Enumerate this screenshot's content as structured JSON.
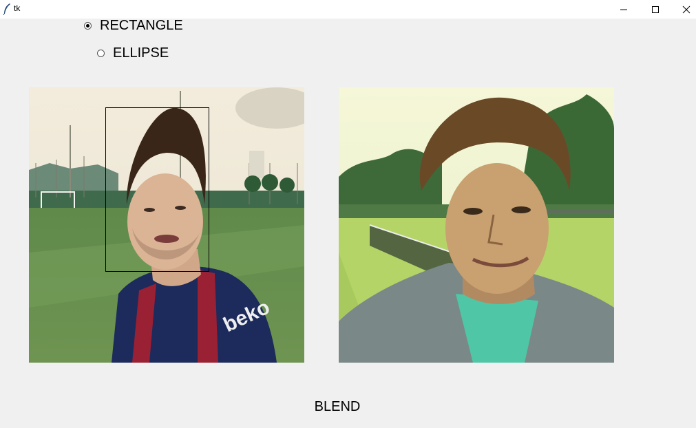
{
  "window": {
    "title": "tk",
    "controls": [
      "minimize",
      "maximize",
      "close"
    ]
  },
  "shape_options": {
    "selected": "RECTANGLE",
    "items": [
      {
        "label": "RECTANGLE",
        "checked": true
      },
      {
        "label": "ELLIPSE",
        "checked": false
      }
    ]
  },
  "images": {
    "left": {
      "subject": "source-face-photo",
      "selection_shape": "rectangle"
    },
    "right": {
      "subject": "target-face-photo"
    }
  },
  "actions": {
    "blend_label": "BLEND"
  }
}
